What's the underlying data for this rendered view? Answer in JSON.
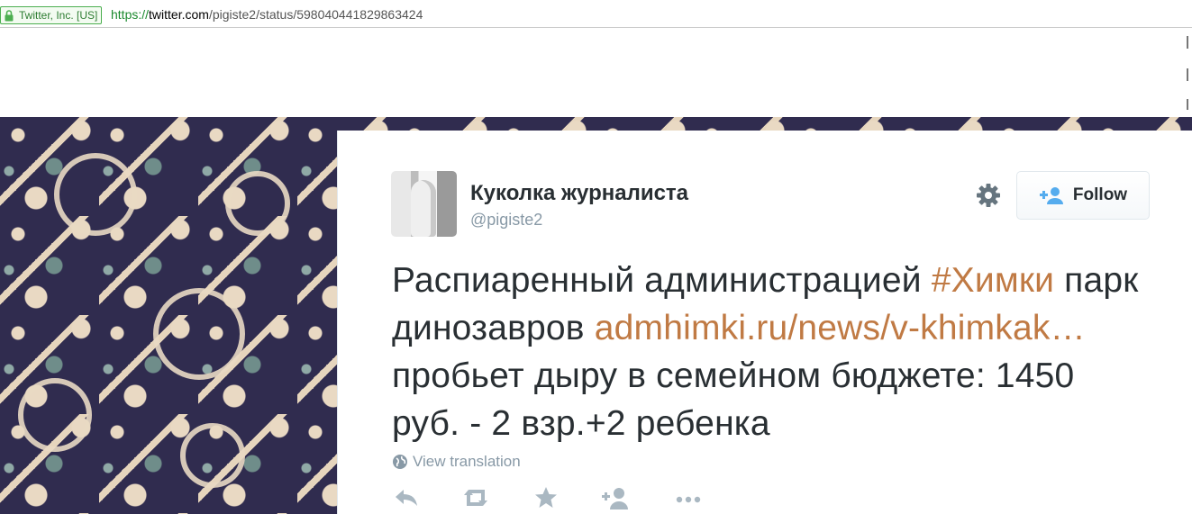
{
  "browser": {
    "security_badge": "Twitter, Inc. [US]",
    "url_protocol": "https://",
    "url_host": "twitter.com",
    "url_path": "/pigiste2/status/598040441829863424"
  },
  "tweet": {
    "display_name": "Куколка журналиста",
    "handle": "@pigiste2",
    "follow_label": "Follow",
    "text_part1": "Распиаренный администрацией ",
    "hashtag": "#Химки",
    "text_part2": " парк динозавров ",
    "link": "admhimki.ru/news/v-khimkak…",
    "text_part3": " пробьет дыру в семейном бюджете: 1450 руб. - 2 взр.+2 ребенка",
    "translate_label": "View translation"
  },
  "colors": {
    "link": "#c07a44",
    "text": "#292f33",
    "muted": "#8899a6"
  },
  "icons": {
    "lock": "lock-icon",
    "gear": "gear-icon",
    "follow": "follow-user-icon",
    "globe": "globe-icon",
    "reply": "reply-icon",
    "retweet": "retweet-icon",
    "favorite": "star-icon",
    "add_user": "add-user-icon",
    "more": "more-icon"
  }
}
